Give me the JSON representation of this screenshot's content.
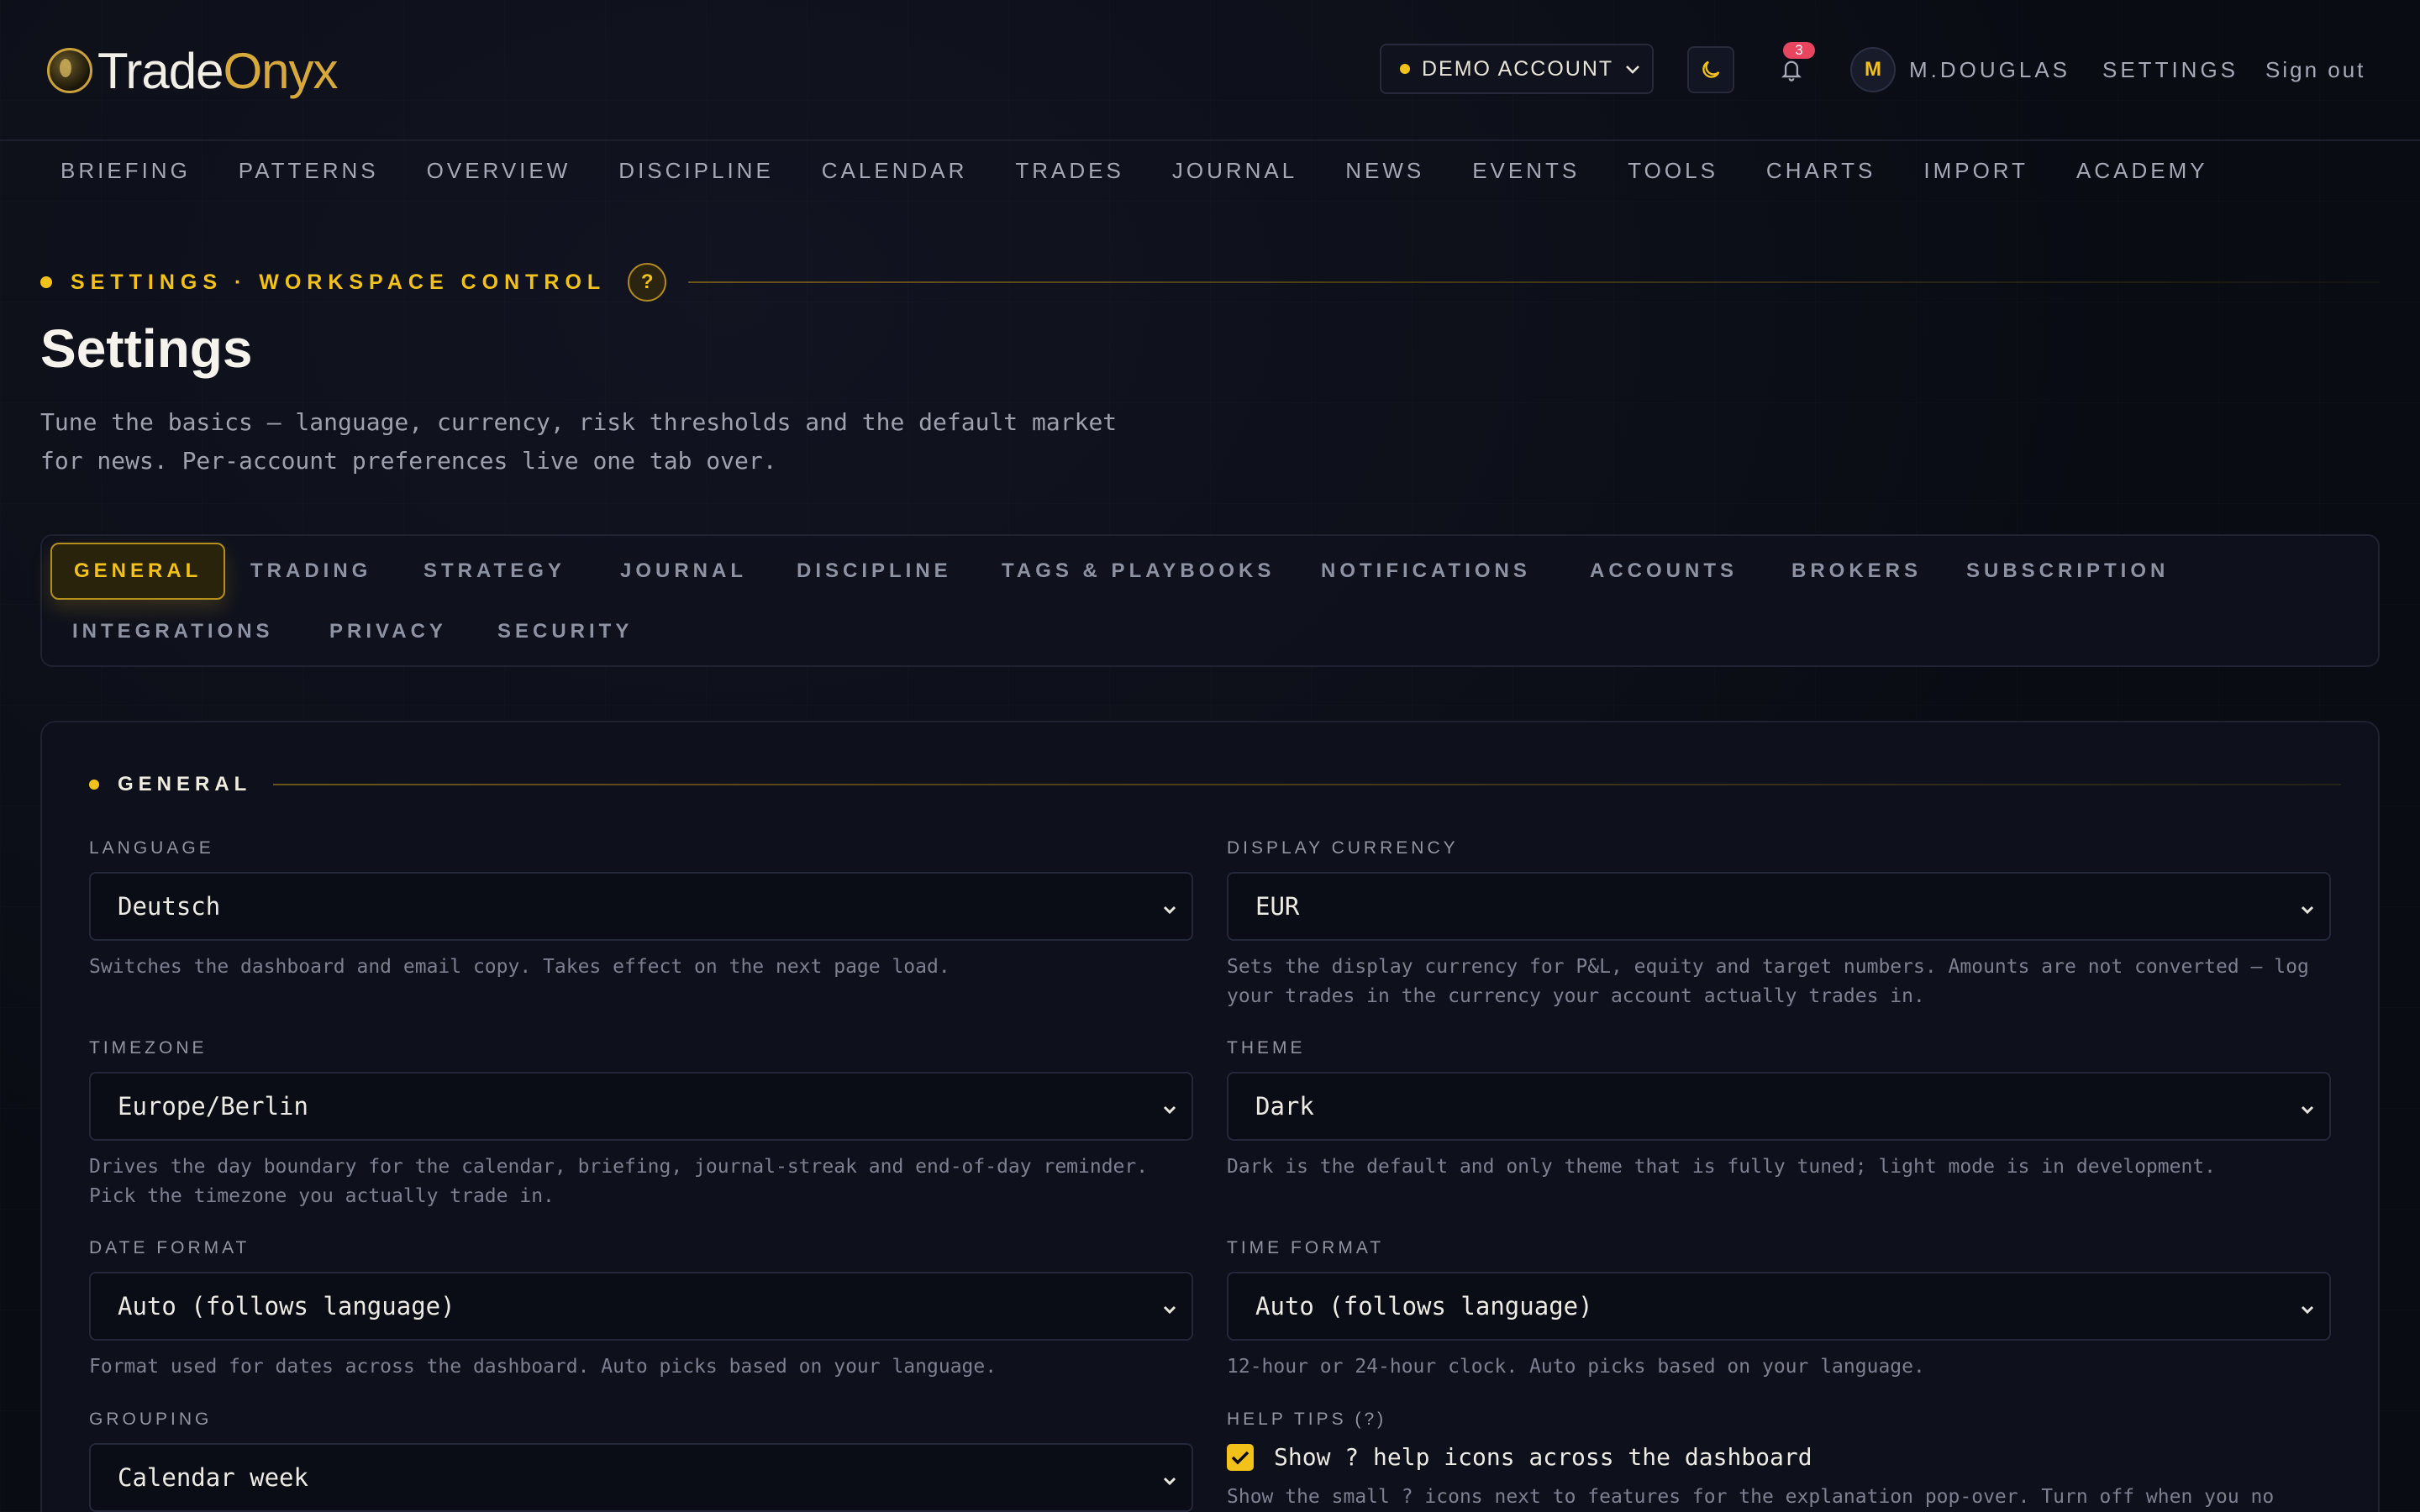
{
  "brand": {
    "name_part1": "Trade",
    "name_part2": "Onyx"
  },
  "header": {
    "account_label": "DEMO ACCOUNT",
    "notification_count": "3",
    "avatar_initial": "M",
    "username": "M.DOUGLAS",
    "settings_link": "SETTINGS",
    "signout_link": "Sign out",
    "colors": {
      "accent": "#f2c21b",
      "badge": "#e8455f",
      "background": "#0a0c14"
    }
  },
  "nav": [
    "BRIEFING",
    "PATTERNS",
    "OVERVIEW",
    "DISCIPLINE",
    "CALENDAR",
    "TRADES",
    "JOURNAL",
    "NEWS",
    "EVENTS",
    "TOOLS",
    "CHARTS",
    "IMPORT",
    "ACADEMY"
  ],
  "hero": {
    "eyebrow": "SETTINGS · WORKSPACE CONTROL",
    "help_glyph": "?",
    "title": "Settings",
    "subtitle": "Tune the basics — language, currency, risk thresholds and the default market for news. Per-account preferences live one tab over."
  },
  "tabs": {
    "active": "GENERAL",
    "items": [
      "GENERAL",
      "TRADING",
      "STRATEGY",
      "JOURNAL",
      "DISCIPLINE",
      "TAGS & PLAYBOOKS",
      "NOTIFICATIONS",
      "ACCOUNTS",
      "BROKERS",
      "SUBSCRIPTION",
      "INTEGRATIONS",
      "PRIVACY",
      "SECURITY"
    ]
  },
  "general": {
    "section_title": "GENERAL",
    "language": {
      "label": "LANGUAGE",
      "value": "Deutsch",
      "help": "Switches the dashboard and email copy. Takes effect on the next page load."
    },
    "currency": {
      "label": "DISPLAY CURRENCY",
      "value": "EUR",
      "help": "Sets the display currency for P&L, equity and target numbers. Amounts are not converted — log your trades in the currency your account actually trades in."
    },
    "timezone": {
      "label": "TIMEZONE",
      "value": "Europe/Berlin",
      "help": "Drives the day boundary for the calendar, briefing, journal-streak and end-of-day reminder. Pick the timezone you actually trade in."
    },
    "theme": {
      "label": "THEME",
      "value": "Dark",
      "help": "Dark is the default and only theme that is fully tuned; light mode is in development."
    },
    "date_format": {
      "label": "DATE FORMAT",
      "value": "Auto (follows language)",
      "help": "Format used for dates across the dashboard. Auto picks based on your language."
    },
    "time_format": {
      "label": "TIME FORMAT",
      "value": "Auto (follows language)",
      "help": "12-hour or 24-hour clock. Auto picks based on your language."
    },
    "grouping": {
      "label": "GROUPING",
      "value": "Calendar week"
    },
    "help_tips": {
      "label": "HELP TIPS (?)",
      "checkbox_label": "Show ? help icons across the dashboard",
      "checked": true,
      "help": "Show the small ? icons next to features for the explanation pop-over. Turn off when you no"
    }
  }
}
